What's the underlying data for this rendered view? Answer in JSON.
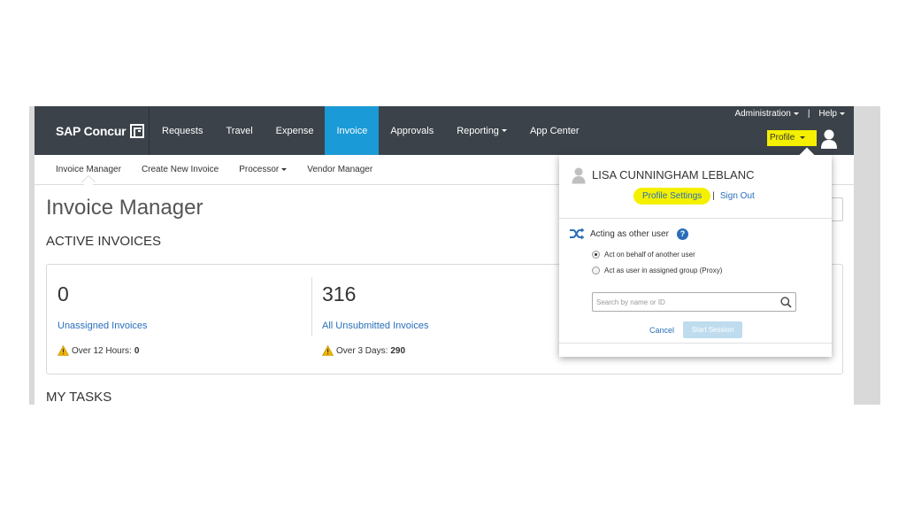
{
  "brand": {
    "name": "SAP Concur"
  },
  "nav": {
    "items": [
      {
        "label": "Requests",
        "active": false,
        "caret": false
      },
      {
        "label": "Travel",
        "active": false,
        "caret": false
      },
      {
        "label": "Expense",
        "active": false,
        "caret": false
      },
      {
        "label": "Invoice",
        "active": true,
        "caret": false
      },
      {
        "label": "Approvals",
        "active": false,
        "caret": false
      },
      {
        "label": "Reporting",
        "active": false,
        "caret": true
      },
      {
        "label": "App Center",
        "active": false,
        "caret": false
      }
    ],
    "administration": "Administration",
    "separator": "|",
    "help": "Help",
    "profile": "Profile"
  },
  "subnav": {
    "items": [
      {
        "label": "Invoice Manager",
        "caret": false
      },
      {
        "label": "Create New Invoice",
        "caret": false
      },
      {
        "label": "Processor",
        "caret": true
      },
      {
        "label": "Vendor Manager",
        "caret": false
      }
    ]
  },
  "main": {
    "title": "Invoice Manager",
    "active_invoices": "ACTIVE INVOICES",
    "my_tasks": "MY TASKS",
    "stats": [
      {
        "count": "0",
        "link": "Unassigned Invoices",
        "warn_label": "Over 12 Hours:",
        "warn_value": "0"
      },
      {
        "count": "316",
        "link": "All Unsubmitted Invoices",
        "warn_label": "Over 3 Days:",
        "warn_value": "290"
      }
    ]
  },
  "dropdown": {
    "user_name": "LISA CUNNINGHAM LEBLANC",
    "profile_settings": "Profile Settings",
    "separator": "|",
    "sign_out": "Sign Out",
    "acting_title": "Acting as other user",
    "help_glyph": "?",
    "radio_options": [
      {
        "label": "Act on behalf of another user",
        "checked": true
      },
      {
        "label": "Act as user in assigned group (Proxy)",
        "checked": false
      }
    ],
    "search_placeholder": "Search by name or ID",
    "cancel": "Cancel",
    "start_session": "Start Session"
  },
  "colors": {
    "topbar": "#3b4249",
    "active_tab": "#1a9ad6",
    "highlight": "#f4f000",
    "link": "#2a6ebb",
    "warning": "#f0b400"
  }
}
